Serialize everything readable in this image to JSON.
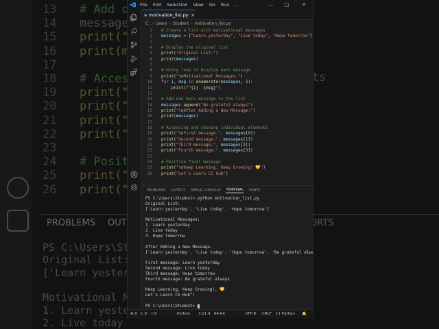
{
  "background": {
    "lines": [
      {
        "num": "13",
        "text": "# Add one",
        "kind": "comment"
      },
      {
        "num": "14",
        "text": "messages",
        "kind": "plain"
      },
      {
        "num": "15",
        "text": "print(\"\\",
        "kind": "fn"
      },
      {
        "num": "16",
        "text": "print(me",
        "kind": "fn"
      },
      {
        "num": "17",
        "text": "",
        "kind": "plain"
      },
      {
        "num": "18",
        "text": "# Access",
        "kind": "comment"
      },
      {
        "num": "19",
        "text": "print(\"\\",
        "kind": "fn"
      },
      {
        "num": "20",
        "text": "print(\"S",
        "kind": "fn"
      },
      {
        "num": "21",
        "text": "print(\"T",
        "kind": "fn"
      },
      {
        "num": "22",
        "text": "print(\"Fo",
        "kind": "fn"
      },
      {
        "num": "23",
        "text": "",
        "kind": "plain"
      },
      {
        "num": "24",
        "text": "# Positiv",
        "kind": "comment"
      },
      {
        "num": "25",
        "text": "print(\"\\",
        "kind": "fn"
      },
      {
        "num": "26",
        "text": "print(\"Le",
        "kind": "fn"
      }
    ],
    "right_fragments": [
      "ts",
      "ORTS"
    ],
    "panel_labels": [
      "PROBLEMS",
      "OUT"
    ],
    "terminal_lines": [
      "PS C:\\Users\\Studen",
      "Original List:",
      "['Learn yesterda",
      "",
      "Motivational Mess",
      "1. Learn yeste",
      "2. Live today"
    ]
  },
  "titlebar": {
    "menu": [
      "File",
      "Edit",
      "Selection",
      "View",
      "Go",
      "Run",
      "…"
    ],
    "controls": [
      "—",
      "□",
      "✕"
    ]
  },
  "activity_icons": [
    "files-icon",
    "search-icon",
    "source-control-icon",
    "run-debug-icon",
    "extensions-icon",
    "account-icon",
    "settings-gear-icon"
  ],
  "tab": {
    "label": "motivation_list.py",
    "close": "×"
  },
  "breadcrumb": [
    "C:",
    "Users",
    "Student",
    "motivation_list.py"
  ],
  "editor": {
    "lines": [
      {
        "n": "1",
        "tokens": [
          [
            "cm",
            "# Create a list with motivational messages"
          ]
        ]
      },
      {
        "n": "2",
        "tokens": [
          [
            "var",
            "messages"
          ],
          [
            "pl",
            " = ["
          ],
          [
            "str",
            "\"Learn yesterday\""
          ],
          [
            "pl",
            ", "
          ],
          [
            "str",
            "\"Live today\""
          ],
          [
            "pl",
            ", "
          ],
          [
            "str",
            "\"Hope tomorrow\""
          ],
          [
            "pl",
            "]"
          ]
        ]
      },
      {
        "n": "3",
        "tokens": []
      },
      {
        "n": "4",
        "tokens": [
          [
            "cm",
            "# Display the original list"
          ]
        ]
      },
      {
        "n": "5",
        "tokens": [
          [
            "fn",
            "print"
          ],
          [
            "pl",
            "("
          ],
          [
            "str",
            "\"Original List:\""
          ],
          [
            "pl",
            ")"
          ]
        ]
      },
      {
        "n": "6",
        "tokens": [
          [
            "fn",
            "print"
          ],
          [
            "pl",
            "("
          ],
          [
            "var",
            "messages"
          ],
          [
            "pl",
            ")"
          ]
        ]
      },
      {
        "n": "7",
        "tokens": []
      },
      {
        "n": "8",
        "tokens": [
          [
            "cm",
            "# Using loop to display each message"
          ]
        ]
      },
      {
        "n": "9",
        "tokens": [
          [
            "fn",
            "print"
          ],
          [
            "pl",
            "("
          ],
          [
            "str",
            "\""
          ],
          [
            "esc",
            "\\n"
          ],
          [
            "str",
            "Motivational Messages:\""
          ],
          [
            "pl",
            ")"
          ]
        ]
      },
      {
        "n": "10",
        "tokens": [
          [
            "kw",
            "for"
          ],
          [
            "pl",
            " "
          ],
          [
            "var",
            "i"
          ],
          [
            "pl",
            ", "
          ],
          [
            "var",
            "msg"
          ],
          [
            "pl",
            " "
          ],
          [
            "kw",
            "in"
          ],
          [
            "pl",
            " "
          ],
          [
            "fn",
            "enumerate"
          ],
          [
            "pl",
            "("
          ],
          [
            "var",
            "messages"
          ],
          [
            "pl",
            ", "
          ],
          [
            "num",
            "1"
          ],
          [
            "pl",
            "):"
          ]
        ]
      },
      {
        "n": "11",
        "tokens": [
          [
            "pl",
            "    "
          ],
          [
            "fn",
            "print"
          ],
          [
            "pl",
            "("
          ],
          [
            "kw",
            "f"
          ],
          [
            "str",
            "\""
          ],
          [
            "pl",
            "{i}"
          ],
          [
            "str",
            ". "
          ],
          [
            "pl",
            "{msg}"
          ],
          [
            "str",
            "\""
          ],
          [
            "pl",
            ")"
          ]
        ]
      },
      {
        "n": "12",
        "tokens": []
      },
      {
        "n": "13",
        "tokens": [
          [
            "cm",
            "# Add one more message to the list"
          ]
        ]
      },
      {
        "n": "14",
        "tokens": [
          [
            "var",
            "messages"
          ],
          [
            "pl",
            "."
          ],
          [
            "fn",
            "append"
          ],
          [
            "pl",
            "("
          ],
          [
            "str",
            "\"Be grateful always\""
          ],
          [
            "pl",
            ")"
          ]
        ]
      },
      {
        "n": "15",
        "tokens": [
          [
            "fn",
            "print"
          ],
          [
            "pl",
            "("
          ],
          [
            "str",
            "\""
          ],
          [
            "esc",
            "\\n"
          ],
          [
            "str",
            "After Adding a New Message:\""
          ],
          [
            "pl",
            ")"
          ]
        ]
      },
      {
        "n": "16",
        "tokens": [
          [
            "fn",
            "print"
          ],
          [
            "pl",
            "("
          ],
          [
            "var",
            "messages"
          ],
          [
            "pl",
            ")"
          ]
        ]
      },
      {
        "n": "17",
        "tokens": []
      },
      {
        "n": "18",
        "tokens": [
          [
            "cm",
            "# Accessing and showing individual elements"
          ]
        ]
      },
      {
        "n": "19",
        "tokens": [
          [
            "fn",
            "print"
          ],
          [
            "pl",
            "("
          ],
          [
            "str",
            "\""
          ],
          [
            "esc",
            "\\n"
          ],
          [
            "str",
            "First message:\""
          ],
          [
            "pl",
            ", "
          ],
          [
            "var",
            "messages"
          ],
          [
            "pl",
            "["
          ],
          [
            "num",
            "0"
          ],
          [
            "pl",
            "])"
          ]
        ]
      },
      {
        "n": "20",
        "tokens": [
          [
            "fn",
            "print"
          ],
          [
            "pl",
            "("
          ],
          [
            "str",
            "\"Second message:\""
          ],
          [
            "pl",
            ", "
          ],
          [
            "var",
            "messages"
          ],
          [
            "pl",
            "["
          ],
          [
            "num",
            "1"
          ],
          [
            "pl",
            "])"
          ]
        ]
      },
      {
        "n": "21",
        "tokens": [
          [
            "fn",
            "print"
          ],
          [
            "pl",
            "("
          ],
          [
            "str",
            "\"Third message:\""
          ],
          [
            "pl",
            ", "
          ],
          [
            "var",
            "messages"
          ],
          [
            "pl",
            "["
          ],
          [
            "num",
            "2"
          ],
          [
            "pl",
            "])"
          ]
        ]
      },
      {
        "n": "22",
        "tokens": [
          [
            "fn",
            "print"
          ],
          [
            "pl",
            "("
          ],
          [
            "str",
            "\"Fourth message:\""
          ],
          [
            "pl",
            ", "
          ],
          [
            "var",
            "messages"
          ],
          [
            "pl",
            "["
          ],
          [
            "num",
            "3"
          ],
          [
            "pl",
            "])"
          ]
        ]
      },
      {
        "n": "23",
        "tokens": []
      },
      {
        "n": "24",
        "tokens": [
          [
            "cm",
            "# Positive final message"
          ]
        ]
      },
      {
        "n": "25",
        "tokens": [
          [
            "fn",
            "print"
          ],
          [
            "pl",
            "("
          ],
          [
            "str",
            "\""
          ],
          [
            "esc",
            "\\n"
          ],
          [
            "str",
            "Keep Learning, Keep Growing! "
          ],
          [
            "emo",
            "💛"
          ],
          [
            "str",
            "\""
          ],
          [
            "pl",
            ")"
          ]
        ]
      },
      {
        "n": "26",
        "tokens": [
          [
            "fn",
            "print"
          ],
          [
            "pl",
            "("
          ],
          [
            "str",
            "\"Let's Learn CS Hub\""
          ],
          [
            "pl",
            ")"
          ]
        ]
      }
    ]
  },
  "panel": {
    "tabs": [
      "PROBLEMS",
      "OUTPUT",
      "DEBUG CONSOLE",
      "TERMINAL",
      "PORTS"
    ],
    "active": "TERMINAL"
  },
  "terminal": {
    "lines": [
      {
        "text": "PS C:\\Users\\Student> ",
        "cmd": "python motivation_list.py"
      },
      {
        "text": "Original List:"
      },
      {
        "text": "['Learn yesterday', 'Live today', 'Hope tomorrow']"
      },
      {
        "text": ""
      },
      {
        "text": "Motivational Messages:"
      },
      {
        "text": "1. Learn yesterday"
      },
      {
        "text": "2. Live today"
      },
      {
        "text": "3. Hope tomorrow"
      },
      {
        "text": ""
      },
      {
        "text": "After Adding a New Message:"
      },
      {
        "text": "['Learn yesterday', 'Live today', 'Hope tomorrow', 'Be grateful always']"
      },
      {
        "text": ""
      },
      {
        "text": "First message: Learn yesterday"
      },
      {
        "text": "Second message: Live today"
      },
      {
        "text": "Third message: Hope tomorrow"
      },
      {
        "text": "Fourth message: Be grateful always"
      },
      {
        "text": ""
      },
      {
        "text": "Keep Learning, Keep Growing!, 💛"
      },
      {
        "text": "Let's Learn CS Hub\")"
      },
      {
        "text": ""
      },
      {
        "text": "PS C:\\Users\\Student> ",
        "cursor": true
      }
    ]
  },
  "statusbar": {
    "errors": "⊗ 0",
    "warnings": "⚠ 0",
    "ports": "⑂ 0",
    "language_left": "Python",
    "version": "3.11.4",
    "bits": "64-bit",
    "encoding": "UTF-8",
    "eol": "CRLF",
    "language": "{} Python",
    "bell": "🔔"
  },
  "colors": {
    "accent": "#0078d4",
    "editor_bg": "#1e1e1e",
    "chrome_bg": "#181818"
  }
}
